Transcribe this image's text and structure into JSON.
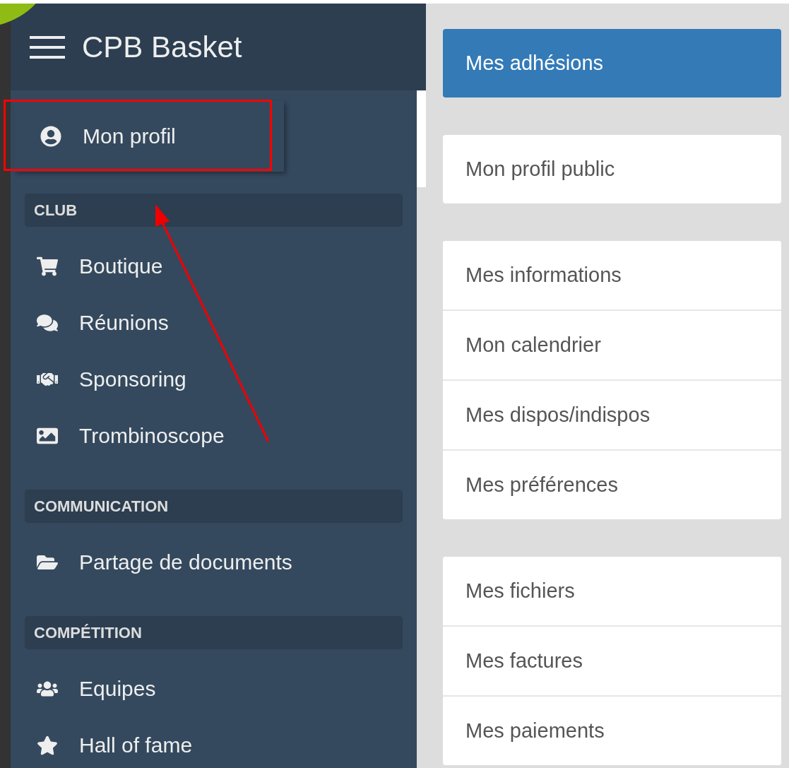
{
  "header": {
    "title": "CPB Basket"
  },
  "sidebar": {
    "items": [
      {
        "kind": "link",
        "label": "Mon profil"
      },
      {
        "kind": "section",
        "label": "CLUB"
      },
      {
        "kind": "link",
        "label": "Boutique"
      },
      {
        "kind": "link",
        "label": "Réunions"
      },
      {
        "kind": "link",
        "label": "Sponsoring"
      },
      {
        "kind": "link",
        "label": "Trombinoscope"
      },
      {
        "kind": "section",
        "label": "COMMUNICATION"
      },
      {
        "kind": "link",
        "label": "Partage de documents"
      },
      {
        "kind": "section",
        "label": "COMPÉTITION"
      },
      {
        "kind": "link",
        "label": "Equipes"
      },
      {
        "kind": "link",
        "label": "Hall of fame"
      }
    ]
  },
  "menu_groups": [
    {
      "items": [
        {
          "label": "Mes adhésions",
          "selected": true
        }
      ]
    },
    {
      "items": [
        {
          "label": "Mon profil public",
          "selected": false
        }
      ]
    },
    {
      "items": [
        {
          "label": "Mes informations",
          "selected": false
        },
        {
          "label": "Mon calendrier",
          "selected": false
        },
        {
          "label": "Mes dispos/indispos",
          "selected": false
        },
        {
          "label": "Mes préférences",
          "selected": false
        }
      ]
    },
    {
      "items": [
        {
          "label": "Mes fichiers",
          "selected": false
        },
        {
          "label": "Mes factures",
          "selected": false
        },
        {
          "label": "Mes paiements",
          "selected": false
        }
      ]
    }
  ]
}
